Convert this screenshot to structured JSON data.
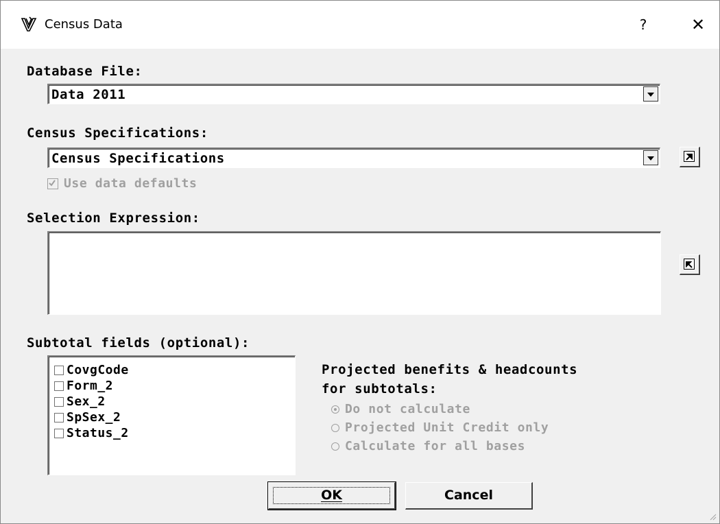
{
  "window": {
    "title": "Census Data",
    "help_label": "?",
    "close_label": "✕"
  },
  "database_file": {
    "label": "Database File:",
    "value": "Data 2011"
  },
  "census_specifications": {
    "label": "Census Specifications:",
    "value": "Census Specifications",
    "use_defaults_label": "Use data defaults",
    "use_defaults_checked": true,
    "use_defaults_disabled": true
  },
  "selection_expression": {
    "label": "Selection Expression:",
    "value": ""
  },
  "subtotal_fields": {
    "label": "Subtotal fields (optional):",
    "items": [
      {
        "label": "CovgCode",
        "checked": false
      },
      {
        "label": "Form_2",
        "checked": false
      },
      {
        "label": "Sex_2",
        "checked": false
      },
      {
        "label": "SpSex_2",
        "checked": false
      },
      {
        "label": "Status_2",
        "checked": false
      }
    ]
  },
  "projected": {
    "title_line1": "Projected benefits & headcounts",
    "title_line2": "for subtotals:",
    "options": [
      {
        "label": "Do not calculate",
        "selected": true
      },
      {
        "label": "Projected Unit Credit only",
        "selected": false
      },
      {
        "label": "Calculate for all bases",
        "selected": false
      }
    ],
    "disabled": true
  },
  "buttons": {
    "ok_label": "OK",
    "cancel_label": "Cancel"
  },
  "colors": {
    "background": "#f0f0f0",
    "disabled_text": "#a0a0a0"
  }
}
